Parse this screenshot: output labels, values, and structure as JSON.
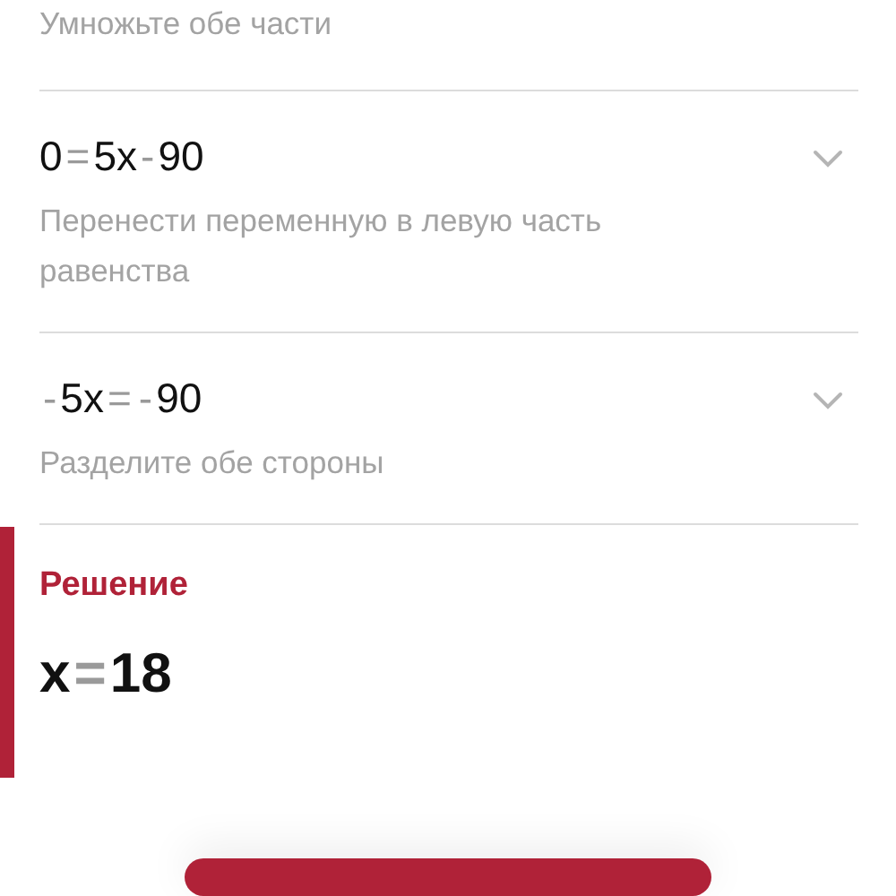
{
  "steps": [
    {
      "description": "Умножьте обе части"
    },
    {
      "equation": [
        {
          "text": "0",
          "kind": "term"
        },
        {
          "text": "=",
          "kind": "operator"
        },
        {
          "text": "5",
          "kind": "term"
        },
        {
          "text": "x",
          "kind": "term"
        },
        {
          "text": "-",
          "kind": "operator"
        },
        {
          "text": "90",
          "kind": "term"
        }
      ],
      "description": "Перенести переменную в левую часть равенства"
    },
    {
      "equation": [
        {
          "text": "-",
          "kind": "operator"
        },
        {
          "text": "5",
          "kind": "term"
        },
        {
          "text": "x",
          "kind": "term"
        },
        {
          "text": "=",
          "kind": "operator"
        },
        {
          "text": "-",
          "kind": "operator"
        },
        {
          "text": "90",
          "kind": "term"
        }
      ],
      "description": "Разделите обе стороны"
    }
  ],
  "solution": {
    "title": "Решение",
    "answer": [
      {
        "text": "x",
        "kind": "term"
      },
      {
        "text": "=",
        "kind": "operator"
      },
      {
        "text": "18",
        "kind": "term"
      }
    ]
  }
}
